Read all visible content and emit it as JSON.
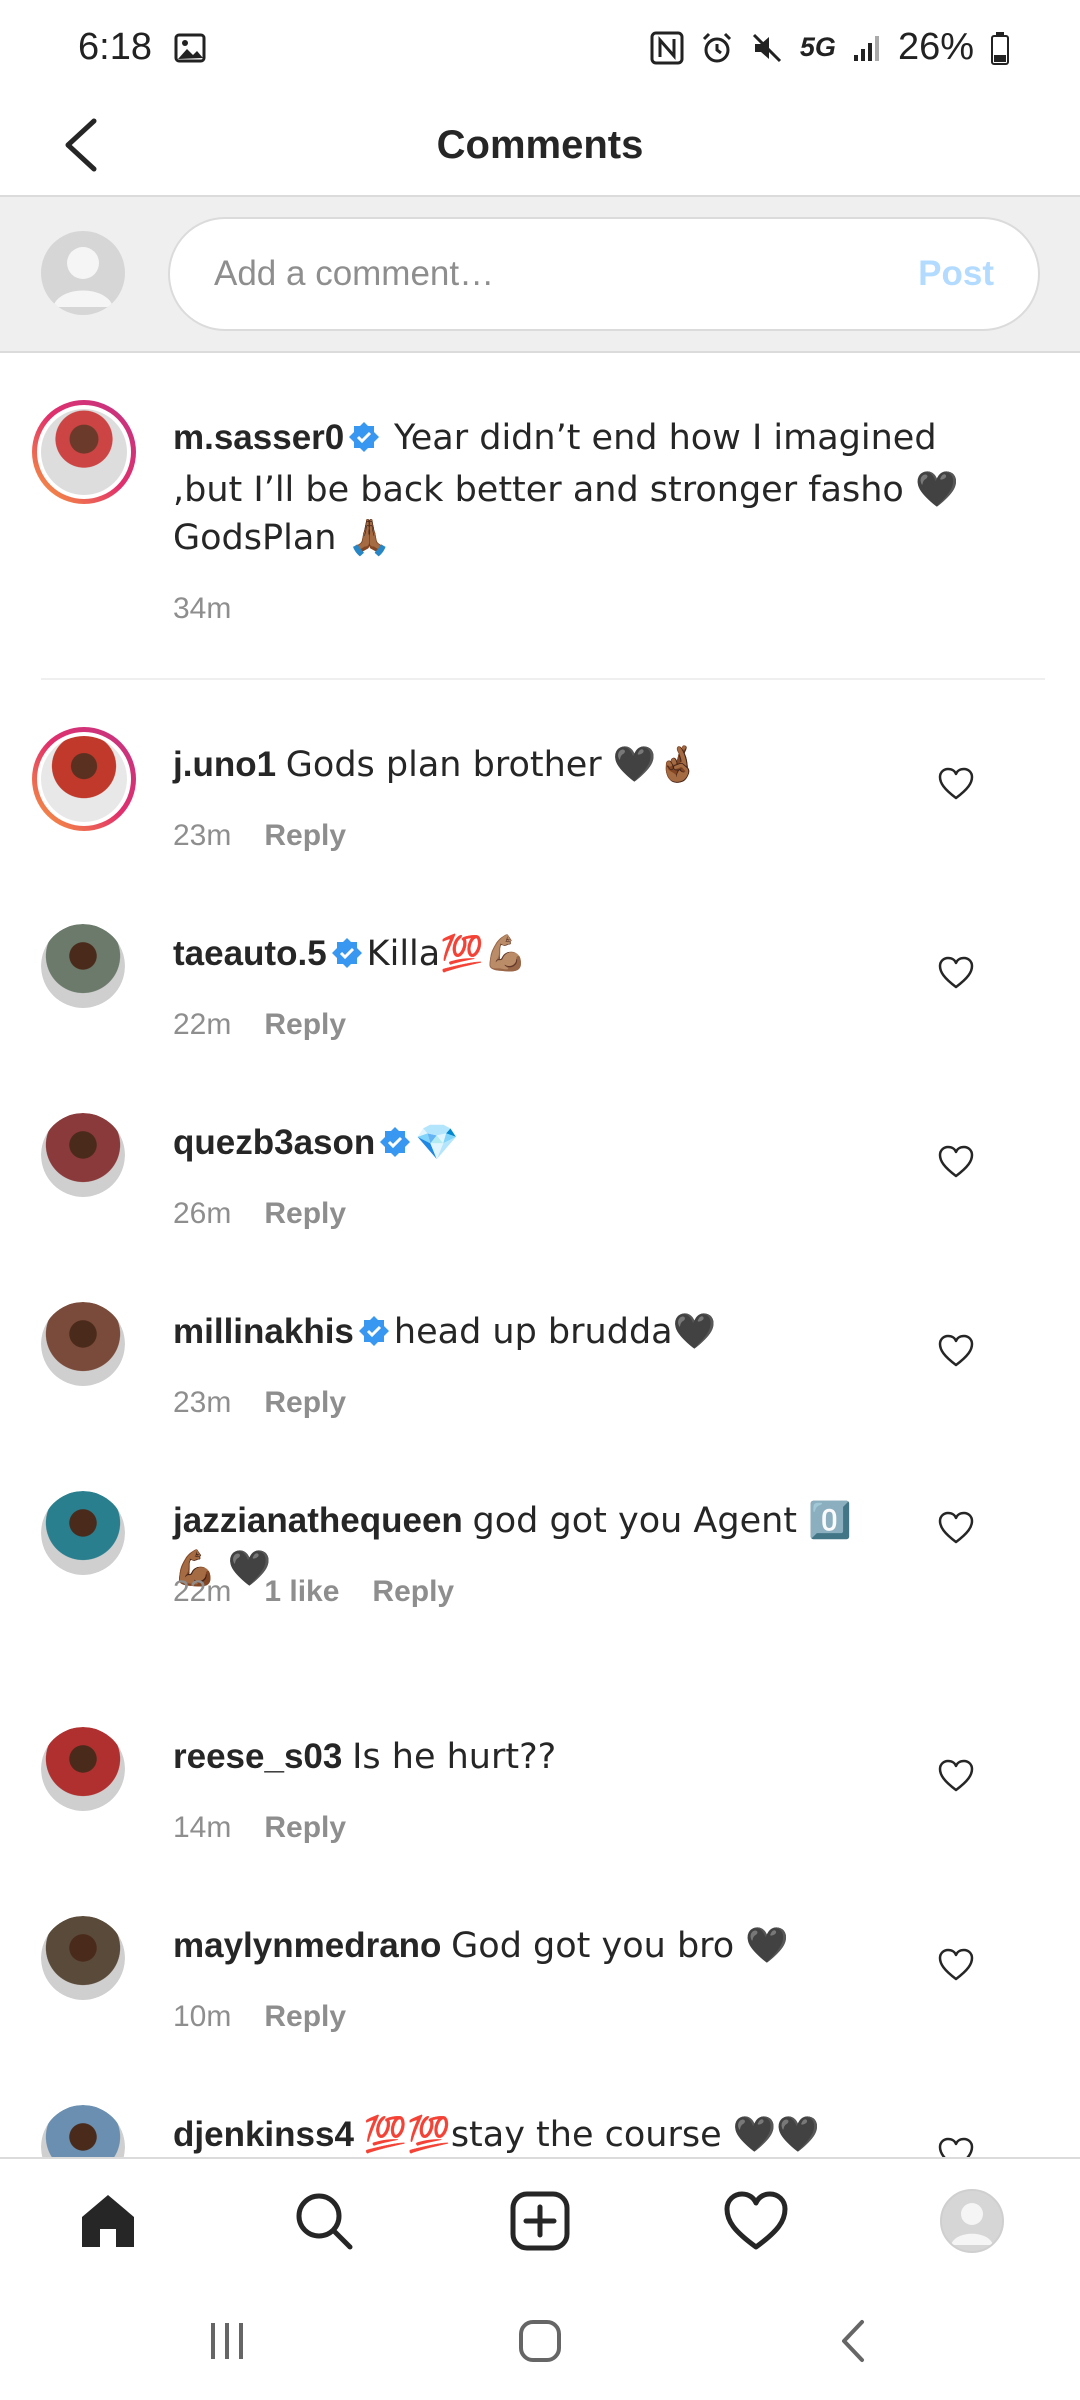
{
  "status_bar": {
    "time": "6:18",
    "network": "5G",
    "battery": "26%"
  },
  "header": {
    "title": "Comments"
  },
  "composer": {
    "placeholder": "Add a comment…",
    "post_label": "Post"
  },
  "caption": {
    "username": "m.sasser0",
    "verified": true,
    "text": "Year didn’t end how I imagined ,but I’ll be back better and stronger fasho 🖤 GodsPlan 🙏🏾",
    "time": "34m"
  },
  "comments": [
    {
      "username": "j.uno1",
      "verified": false,
      "story_ring": true,
      "text": "Gods plan brother 🖤🤞🏾",
      "time": "23m",
      "likes": "",
      "reply_label": "Reply",
      "avatar_color": "#c0392b"
    },
    {
      "username": "taeauto.5",
      "verified": true,
      "story_ring": false,
      "text": "Killa💯💪🏽",
      "time": "22m",
      "likes": "",
      "reply_label": "Reply",
      "avatar_color": "#6b7a6b"
    },
    {
      "username": "quezb3ason",
      "verified": true,
      "story_ring": false,
      "text": "💎",
      "time": "26m",
      "likes": "",
      "reply_label": "Reply",
      "avatar_color": "#8a3a3a"
    },
    {
      "username": "millinakhis",
      "verified": true,
      "story_ring": false,
      "text": "head up brudda🖤",
      "time": "23m",
      "likes": "",
      "reply_label": "Reply",
      "avatar_color": "#7a4b3a"
    },
    {
      "username": "jazzianathequeen",
      "verified": false,
      "story_ring": false,
      "text": "god got you Agent 0️⃣ 💪🏾 🖤",
      "time": "22m",
      "likes": "1 like",
      "reply_label": "Reply",
      "avatar_color": "#2a7f8f"
    },
    {
      "username": "reese_s03",
      "verified": false,
      "story_ring": false,
      "text": "Is he hurt??",
      "time": "14m",
      "likes": "",
      "reply_label": "Reply",
      "avatar_color": "#b03030"
    },
    {
      "username": "maylynmedrano",
      "verified": false,
      "story_ring": false,
      "text": "God got you bro 🖤",
      "time": "10m",
      "likes": "",
      "reply_label": "Reply",
      "avatar_color": "#5a4a3a"
    },
    {
      "username": "djenkinss4",
      "verified": false,
      "story_ring": false,
      "text": "💯💯stay the course 🖤🖤",
      "time": "",
      "likes": "",
      "reply_label": "",
      "avatar_color": "#6a8fb0"
    }
  ],
  "icons": {
    "back": "chevron-left-icon",
    "verified": "verified-badge-icon",
    "heart": "heart-outline-icon",
    "nav": [
      "home-icon",
      "search-icon",
      "new-post-icon",
      "activity-heart-icon",
      "profile-avatar"
    ],
    "system": [
      "recent-apps-icon",
      "home-button-icon",
      "back-icon"
    ]
  },
  "colors": {
    "verified": "#3897f0",
    "post_disabled": "#b3dbff",
    "secondary_text": "#8e8e8e"
  }
}
